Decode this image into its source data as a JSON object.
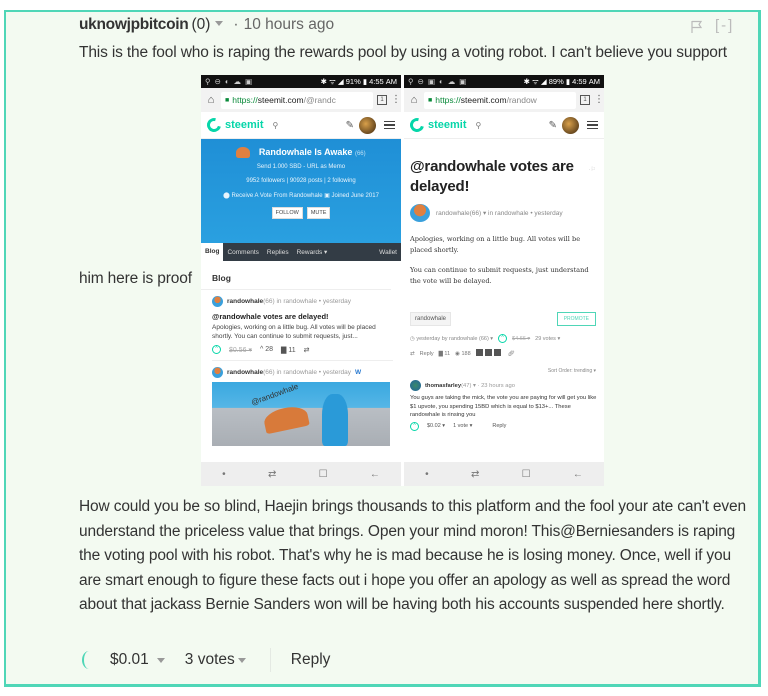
{
  "comment": {
    "author": "uknowjpbitcoin",
    "reputation": "(0)",
    "separator": "·",
    "timestamp": "10 hours ago",
    "collapse_label": "[-]",
    "body_line1": "This is the fool who is raping the rewards pool by using a voting robot. I can't believe you support",
    "body_line2": "him here is proof",
    "body_paragraph2": "How could you be so blind, Haejin brings thousands to this platform and the fool your ate can't even understand the priceless value that brings. Open your mind moron! This@Berniesanders is raping the voting pool with his robot. That's why he is mad because he is losing money. Once, well if you are smart enough to figure these facts out i hope you offer an apology as well as spread the word about that jackass Bernie Sanders won will be having both his accounts suspended here shortly.",
    "payout": "$0.01",
    "votes": "3 votes",
    "reply_label": "Reply",
    "accent_color": "#4fd6b7"
  },
  "screenshot": {
    "left_phone": {
      "status_left": "⚲ ⊖ ◐ ☁ ▣",
      "status_right": "✱ ᯤ ◢ 91% ▮ 4:55 AM",
      "url_https": "https://",
      "url_domain": "steemit.com",
      "url_path": "/@randc",
      "tabs_count": "1",
      "logo_text": "steemit",
      "profile_name": "Randowhale Is Awake",
      "profile_rep": "(66)",
      "profile_line1": "Send 1.000 SBD - URL as Memo",
      "profile_line2": "9952 followers  |  90928 posts  |  2 following",
      "profile_line3": "⬤ Receive A Vote From Randowhale     ▣ Joined June 2017",
      "follow_label": "FOLLOW",
      "mute_label": "MUTE",
      "tabs": [
        "Blog",
        "Comments",
        "Replies",
        "Rewards ▾",
        "Wallet"
      ],
      "blog_heading": "Blog",
      "card1": {
        "author": "randowhale",
        "meta": " (66) in randowhale • yesterday",
        "title": "@randowhale votes are delayed!",
        "excerpt": "Apologies, working on a little bug.  All votes will be placed shortly. You can continue to submit requests, just...",
        "payout": "$0.56 ▾",
        "votes": "^ 28",
        "comments": "▇ 11",
        "resteem": "⇄"
      },
      "card2": {
        "author": "randowhale",
        "meta": " (66) in randowhale • yesterday",
        "badge": "W",
        "image_caption": "@randowhale"
      }
    },
    "right_phone": {
      "status_left": "⚲ ⊖ ▣ ◐ ☁ ▣",
      "status_right": "✱ ᯤ ◢ 89% ▮ 4:59 AM",
      "url_https": "https://",
      "url_domain": "steemit.com",
      "url_path": "/randow",
      "tabs_count": "1",
      "logo_text": "steemit",
      "post_title": "@randowhale votes are delayed!",
      "post_author": "randowhale",
      "post_meta": " (66) ▾  in randowhale • yesterday",
      "post_para1": "Apologies, working on a little bug.  All votes will be placed shortly.",
      "post_para2": "You can continue to submit requests, just understand the vote will be delayed.",
      "tag": "randowhale",
      "promote_label": "PROMOTE",
      "post_foot_time": "◷ yesterday by randowhale (66) ▾",
      "post_foot_payout": "$4.66 ▾",
      "post_foot_votes": "29 votes ▾",
      "reply_label": "Reply",
      "comment_count": "▇ 11",
      "view_count": "◉ 188",
      "sort_order": "Sort Order:  trending ▾",
      "reply": {
        "author": "thomasfarley",
        "meta": " (47) ▾  · 23 hours ago",
        "body": "You guys are taking the mick, the vote you are paying for will get you like $1 upvote, you spending 15BD which is equal to $13+... These randowhale is rinsing you",
        "payout": "$0.02 ▾",
        "votes": "1 vote ▾",
        "reply_label": "Reply"
      }
    }
  }
}
